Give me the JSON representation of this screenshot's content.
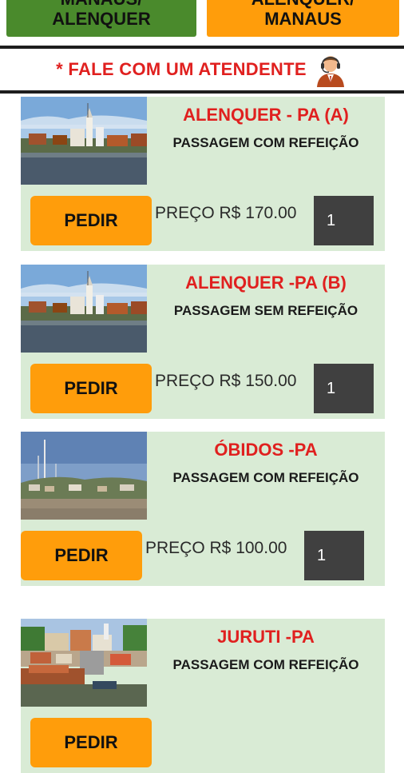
{
  "top_buttons": [
    {
      "line1": "MANAUS/",
      "line2": "ALENQUER"
    },
    {
      "line1": "ALENQUER/",
      "line2": "MANAUS"
    }
  ],
  "attendant": {
    "label": "* FALE COM UM ATENDENTE",
    "icon": "attendant-headset-icon"
  },
  "products": [
    {
      "destination": "ALENQUER - PA (A)",
      "description": "PASSAGEM COM REFEIÇÃO",
      "order_label": "PEDIR",
      "price_label": "PREÇO R$ 170.00",
      "quantity": "1"
    },
    {
      "destination": "ALENQUER -PA (B)",
      "description": "PASSAGEM SEM REFEIÇÃO",
      "order_label": "PEDIR",
      "price_label": "PREÇO R$ 150.00",
      "quantity": "1"
    },
    {
      "destination": "ÓBIDOS -PA",
      "description": "PASSAGEM COM REFEIÇÃO",
      "order_label": "PEDIR",
      "price_label": "PREÇO R$ 100.00",
      "quantity": "1"
    },
    {
      "destination": "JURUTI -PA",
      "description": "PASSAGEM COM REFEIÇÃO",
      "order_label": "PEDIR",
      "price_label": "",
      "quantity": ""
    }
  ],
  "colors": {
    "accent_orange": "#ff9d0b",
    "accent_green": "#4a8a2c",
    "title_red": "#e0201f",
    "card_background": "#d9ebd5",
    "quantity_background": "#404040"
  }
}
